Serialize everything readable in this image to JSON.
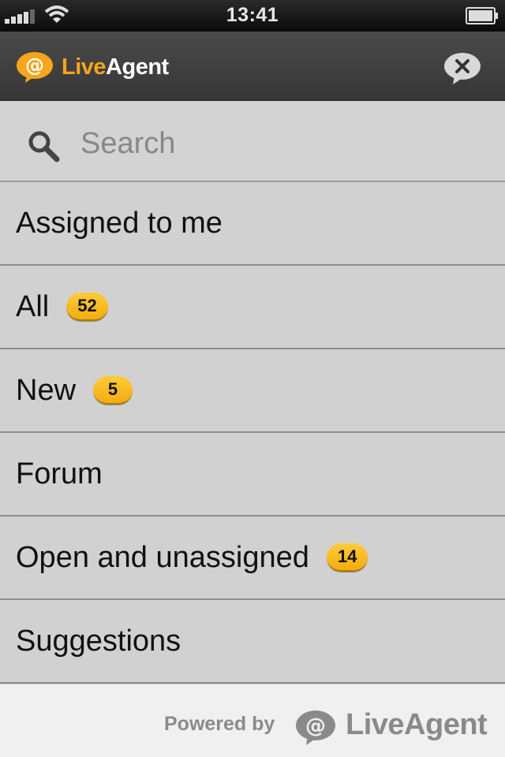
{
  "status_bar": {
    "time": "13:41"
  },
  "header": {
    "logo_prefix": "Live",
    "logo_suffix": "Agent",
    "brand_color": "#f7a51c"
  },
  "search": {
    "placeholder": "Search",
    "value": ""
  },
  "menu": {
    "items": [
      {
        "label": "Assigned to me"
      },
      {
        "label": "All",
        "badge": "52"
      },
      {
        "label": "New",
        "badge": "5"
      },
      {
        "label": "Forum"
      },
      {
        "label": "Open and unassigned",
        "badge": "14"
      },
      {
        "label": "Suggestions"
      }
    ]
  },
  "footer": {
    "powered_by": "Powered by",
    "brand": "LiveAgent"
  },
  "icons": {
    "signal": "signal-icon",
    "wifi": "wifi-icon",
    "battery": "battery-icon",
    "logo": "liveagent-logo-icon",
    "close": "close-chat-icon",
    "search": "search-icon"
  }
}
